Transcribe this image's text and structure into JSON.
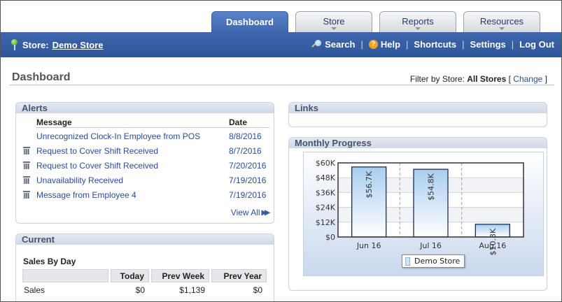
{
  "tabs": [
    {
      "label": "Dashboard",
      "active": true
    },
    {
      "label": "Store",
      "active": false
    },
    {
      "label": "Reports",
      "active": false
    },
    {
      "label": "Resources",
      "active": false
    }
  ],
  "topbar": {
    "store_label": "Store:",
    "store_name": "Demo Store",
    "links": {
      "search": "Search",
      "help": "Help",
      "shortcuts": "Shortcuts",
      "settings": "Settings",
      "logout": "Log Out"
    }
  },
  "page": {
    "title": "Dashboard",
    "filter_label": "Filter by Store:",
    "filter_value": "All Stores",
    "filter_change": "Change"
  },
  "alerts": {
    "title": "Alerts",
    "col_message": "Message",
    "col_date": "Date",
    "rows": [
      {
        "message": "Unrecognized Clock-In Employee from POS",
        "date": "8/8/2016",
        "trash": false
      },
      {
        "message": "Request to Cover Shift Received",
        "date": "8/7/2016",
        "trash": true
      },
      {
        "message": "Request to Cover Shift Received",
        "date": "7/20/2016",
        "trash": true
      },
      {
        "message": "Unavailability Received",
        "date": "7/19/2016",
        "trash": true
      },
      {
        "message": "Message from Employee 4",
        "date": "7/19/2016",
        "trash": true
      }
    ],
    "view_all": "View All"
  },
  "current": {
    "title": "Current",
    "subtitle": "Sales By Day",
    "columns": [
      "Today",
      "Prev Week",
      "Prev Year"
    ],
    "rows": [
      {
        "label": "Sales",
        "values": [
          "$0",
          "$1,139",
          "$0"
        ]
      }
    ]
  },
  "links_panel": {
    "title": "Links"
  },
  "monthly": {
    "title": "Monthly Progress"
  },
  "chart_data": {
    "type": "bar",
    "categories": [
      "Jun 16",
      "Jul 16",
      "Aug 16"
    ],
    "series": [
      {
        "name": "Demo Store",
        "values": [
          56700,
          54800,
          10300
        ]
      }
    ],
    "data_labels": [
      "$56.7K",
      "$54.8K",
      "$10.3K"
    ],
    "y_ticks": [
      "$0",
      "$12K",
      "$24K",
      "$36K",
      "$48K",
      "$60K"
    ],
    "ylim": [
      0,
      60000
    ],
    "legend": "bottom",
    "colors": {
      "bar_top": "#a9cdf0",
      "bar_bottom": "#ffffff",
      "bar_border": "#1a2d52"
    }
  }
}
